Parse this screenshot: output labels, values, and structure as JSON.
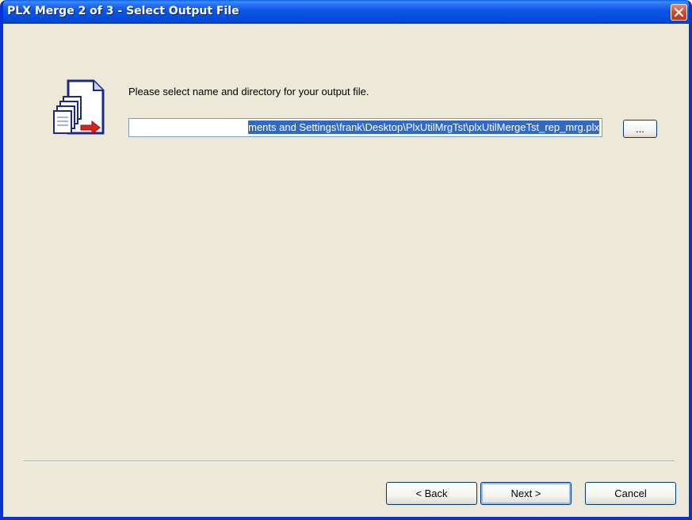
{
  "window": {
    "title": "PLX Merge 2 of 3 - Select Output File",
    "close_icon": "close-icon"
  },
  "main": {
    "icon": "merge-files-icon",
    "prompt": "Please select name and directory for your output file.",
    "path_value": "ments and Settings\\frank\\Desktop\\PlxUtilMrgTst\\plxUtilMergeTst_rep_mrg.plx",
    "browse_label": "..."
  },
  "footer": {
    "back_label": "< Back",
    "next_label": "Next >",
    "cancel_label": "Cancel"
  },
  "colors": {
    "titlebar": "#0b56e3",
    "dialog_bg": "#ece9d8",
    "selection": "#316ac5",
    "close_button": "#d8472a"
  }
}
